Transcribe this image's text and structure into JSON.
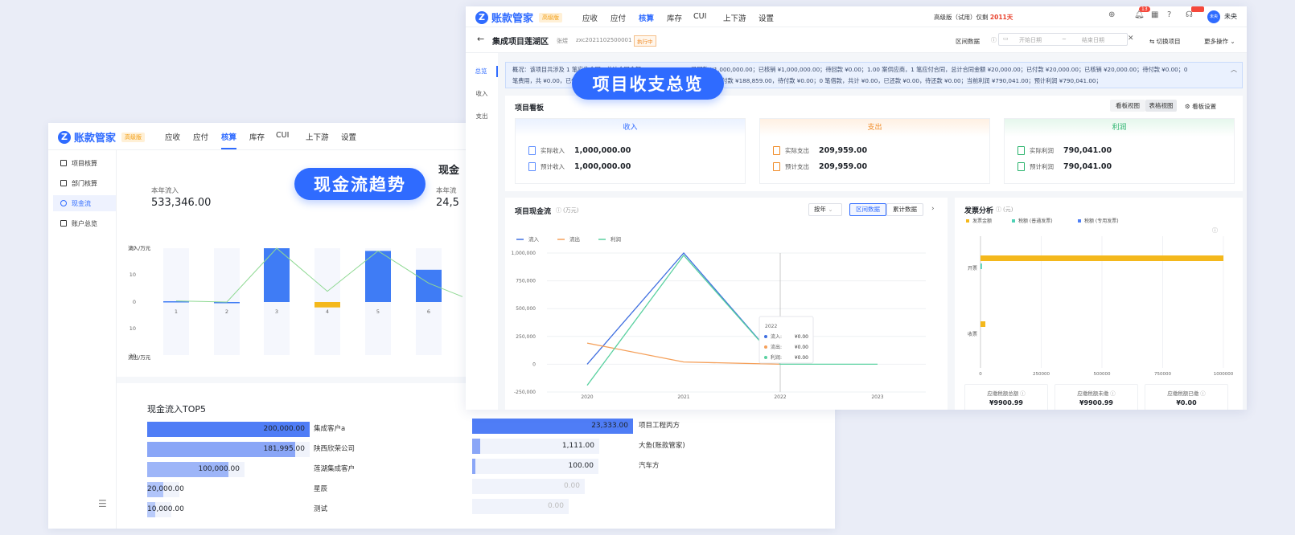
{
  "app": {
    "logo_text": "账款管家",
    "edition_badge": "高级版"
  },
  "nav": [
    "应收",
    "应付",
    "核算",
    "库存",
    "CUI",
    "上下游",
    "设置"
  ],
  "nav_active": "核算",
  "back": {
    "sidebar": [
      {
        "label": "项目核算",
        "active": false
      },
      {
        "label": "部门核算",
        "active": false
      },
      {
        "label": "现金流",
        "active": true
      },
      {
        "label": "账户总览",
        "active": false
      }
    ],
    "inflow_label": "本年流入",
    "inflow_value": "533,346.00",
    "right_partial_title": "现金",
    "right_partial_label": "本年流",
    "right_partial_value": "24,5",
    "top5_title": "现金流入TOP5"
  },
  "callouts": {
    "cashflow": "现金流趋势",
    "summary": "项目收支总览"
  },
  "chart_data": [
    {
      "type": "bar",
      "ylabel_top": "流入/万元",
      "ylabel_bottom": "流出/万元",
      "categories": [
        "1",
        "2",
        "3",
        "4",
        "5",
        "6"
      ],
      "y_ticks": [
        "20",
        "10",
        "0",
        "10",
        "20"
      ],
      "ylim": [
        -20,
        20
      ],
      "series": [
        {
          "values": [
            0.3,
            0,
            20,
            -2,
            19,
            12
          ],
          "color": "#3f7cf5"
        },
        {
          "values": [
            0.4,
            0,
            20,
            4,
            19,
            7
          ],
          "color": "#8fd993"
        }
      ]
    },
    {
      "type": "bar",
      "title": "现金流入TOP5",
      "orientation": "horizontal",
      "series": [
        {
          "categories": [
            "集成客户a",
            "陕西欣荣公司",
            "莲湖集成客户",
            "星辰",
            "测试"
          ],
          "values": [
            200000.0,
            181995.0,
            100000.0,
            20000.0,
            10000.0
          ],
          "labels": [
            "200,000.00",
            "181,995.00",
            "100,000.00",
            "20,000.00",
            "10,000.00"
          ]
        },
        {
          "categories": [
            "项目工程丙方",
            "大鱼(账款管家)",
            "汽车方",
            "",
            ""
          ],
          "values": [
            23333.0,
            1111.0,
            100.0,
            0,
            0
          ],
          "labels": [
            "23,333.00",
            "1,111.00",
            "100.00",
            "0.00",
            "0.00"
          ]
        }
      ]
    },
    {
      "type": "line",
      "title": "项目现金流",
      "unit": "(万元)",
      "x": [
        "2020",
        "2021",
        "2022",
        "2023"
      ],
      "y_ticks": [
        "1,000,000",
        "750,000",
        "500,000",
        "250,000",
        "0",
        "-250,000"
      ],
      "ylim": [
        -250000,
        1000000
      ],
      "series": [
        {
          "name": "流入",
          "color": "#3f6fe0",
          "values": [
            0,
            1000000,
            0,
            null
          ]
        },
        {
          "name": "流出",
          "color": "#f5a05a",
          "values": [
            190000,
            20000,
            0,
            null
          ]
        },
        {
          "name": "利润",
          "color": "#5ad1a0",
          "values": [
            -190000,
            980000,
            0,
            0
          ]
        }
      ],
      "tooltip": {
        "title": "2022",
        "rows": [
          [
            "流入:",
            "¥0.00"
          ],
          [
            "流出:",
            "¥0.00"
          ],
          [
            "利润:",
            "¥0.00"
          ]
        ]
      }
    },
    {
      "type": "bar",
      "title": "发票分析",
      "unit": "(元)",
      "orientation": "horizontal",
      "categories": [
        "开票",
        "收票"
      ],
      "x_ticks": [
        "0",
        "250000",
        "500000",
        "750000",
        "1000000"
      ],
      "xlim": [
        0,
        1000000
      ],
      "series": [
        {
          "name": "发票金额",
          "color": "#f4b81c",
          "values": [
            1000000,
            20000
          ]
        },
        {
          "name": "税额 (普通发票)",
          "color": "#4fd1b5",
          "values": [
            6000,
            0
          ]
        },
        {
          "name": "税额 (专用发票)",
          "color": "#4e7ff5",
          "values": [
            0,
            0
          ]
        }
      ]
    }
  ],
  "front": {
    "edition_text": "高级版（试用）仅剩",
    "days_left": "2011天",
    "notif_count": "13",
    "user_name": "未央",
    "avatar_text": "未央",
    "project_title": "集成项目莲湖区",
    "project_owner": "张煜",
    "project_code": "zxc2021102500001",
    "project_status": "执行中",
    "interval_label": "区间数据",
    "start_placeholder": "开始日期",
    "end_placeholder": "结束日期",
    "switch_project": "切换项目",
    "more_actions": "更多操作",
    "side_tabs": [
      "总览",
      "收入",
      "支出"
    ],
    "summary_line1": "概况：该项目共涉及 1 笔应收合同，总计合同金额 ¥1,000,000.00；已回款 ¥1,000,000.00；已核销 ¥1,000,000.00；待回款 ¥0.00；1.00 案供应商，1 笔应付合同，总计合同金额 ¥20,000.00；已付款 ¥20,000.00；已核销 ¥20,000.00；待付款 ¥0.00；0",
    "summary_line2": "笔费用，共 ¥0.00，已付款 ¥0.00，待付款 ¥0.00；共计支出 ¥209,959.00，已付款 ¥188,859.00，待付款 ¥0.00；0 笔借款，共计 ¥0.00，已还款 ¥0.00，待还款 ¥0.00；当前利润 ¥790,041.00；预计利润 ¥790,041.00；",
    "board_title": "项目看板",
    "board_view": "看板视图",
    "table_view": "表格视图",
    "board_settings": "看板设置",
    "cards": [
      {
        "title": "收入",
        "rows": [
          {
            "label": "实际收入",
            "value": "1,000,000.00"
          },
          {
            "label": "预计收入",
            "value": "1,000,000.00"
          }
        ]
      },
      {
        "title": "支出",
        "rows": [
          {
            "label": "实际支出",
            "value": "209,959.00"
          },
          {
            "label": "预计支出",
            "value": "209,959.00"
          }
        ]
      },
      {
        "title": "利润",
        "rows": [
          {
            "label": "实际利润",
            "value": "790,041.00"
          },
          {
            "label": "预计利润",
            "value": "790,041.00"
          }
        ]
      }
    ],
    "cf_period": "按年",
    "cf_interval": "区间数据",
    "cf_cumulative": "累计数据",
    "inv_stats": [
      {
        "label": "应缴税额总额",
        "value": "¥9900.99"
      },
      {
        "label": "应缴税额未缴",
        "value": "¥9900.99"
      },
      {
        "label": "应缴税额已缴",
        "value": "¥0.00"
      }
    ]
  },
  "colors": {
    "primary": "#2f6bff",
    "income": "#2f6bff",
    "expense": "#f08a24",
    "profit": "#27b36b"
  }
}
